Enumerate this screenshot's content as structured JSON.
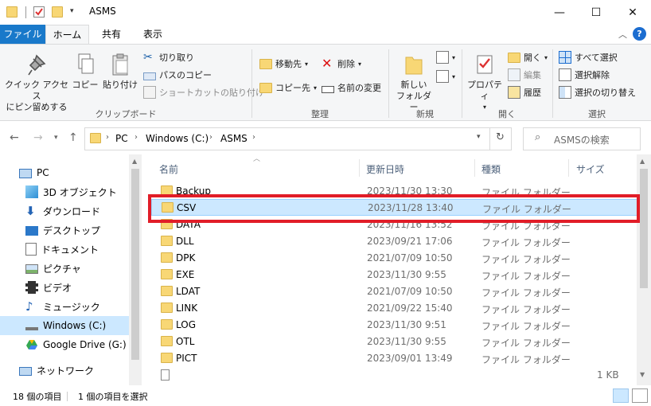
{
  "window": {
    "title": "ASMS",
    "minimize": "—",
    "maximize": "☐",
    "close": "✕"
  },
  "tabs": [
    "ファイル",
    "ホーム",
    "共有",
    "表示"
  ],
  "ribbon": {
    "clipboard": {
      "label": "クリップボード",
      "pin_line1": "クイック アクセス",
      "pin_line2": "にピン留めする",
      "copy": "コピー",
      "paste": "貼り付け",
      "cut": "切り取り",
      "copy_path": "パスのコピー",
      "paste_shortcut": "ショートカットの貼り付け"
    },
    "organize": {
      "label": "整理",
      "move_to": "移動先",
      "copy_to": "コピー先",
      "delete": "削除",
      "rename": "名前の変更"
    },
    "new": {
      "label": "新規",
      "new_folder_line1": "新しい",
      "new_folder_line2": "フォルダー"
    },
    "open": {
      "label": "開く",
      "properties": "プロパティ",
      "open": "開く",
      "edit": "編集",
      "history": "履歴"
    },
    "select": {
      "label": "選択",
      "select_all": "すべて選択",
      "select_none": "選択解除",
      "invert": "選択の切り替え"
    }
  },
  "address": {
    "crumbs": [
      "PC",
      "Windows (C:)",
      "ASMS"
    ],
    "search_placeholder": "ASMSの検索"
  },
  "nav": [
    {
      "label": "PC",
      "icon": "pc-icon"
    },
    {
      "label": "3D オブジェクト",
      "icon": "3d-objects-icon"
    },
    {
      "label": "ダウンロード",
      "icon": "download-icon"
    },
    {
      "label": "デスクトップ",
      "icon": "desktop-icon"
    },
    {
      "label": "ドキュメント",
      "icon": "documents-icon"
    },
    {
      "label": "ピクチャ",
      "icon": "pictures-icon"
    },
    {
      "label": "ビデオ",
      "icon": "videos-icon"
    },
    {
      "label": "ミュージック",
      "icon": "music-icon"
    },
    {
      "label": "Windows (C:)",
      "icon": "drive-icon",
      "selected": true
    },
    {
      "label": "Google Drive (G:)",
      "icon": "google-drive-icon"
    },
    {
      "label": "ネットワーク",
      "icon": "network-icon"
    }
  ],
  "columns": [
    "名前",
    "更新日時",
    "種類",
    "サイズ"
  ],
  "files": [
    {
      "name": "Backup",
      "date": "2023/11/30 13:30",
      "type": "ファイル フォルダー"
    },
    {
      "name": "CSV",
      "date": "2023/11/28 13:40",
      "type": "ファイル フォルダー",
      "selected": true
    },
    {
      "name": "DATA",
      "date": "2023/11/16 13:52",
      "type": "ファイル フォルダー"
    },
    {
      "name": "DLL",
      "date": "2023/09/21 17:06",
      "type": "ファイル フォルダー"
    },
    {
      "name": "DPK",
      "date": "2021/07/09 10:50",
      "type": "ファイル フォルダー"
    },
    {
      "name": "EXE",
      "date": "2023/11/30 9:55",
      "type": "ファイル フォルダー"
    },
    {
      "name": "LDAT",
      "date": "2021/07/09 10:50",
      "type": "ファイル フォルダー"
    },
    {
      "name": "LINK",
      "date": "2021/09/22 15:40",
      "type": "ファイル フォルダー"
    },
    {
      "name": "LOG",
      "date": "2023/11/30 9:51",
      "type": "ファイル フォルダー"
    },
    {
      "name": "OTL",
      "date": "2023/11/30 9:55",
      "type": "ファイル フォルダー"
    },
    {
      "name": "PICT",
      "date": "2023/09/01 13:49",
      "type": "ファイル フォルダー"
    }
  ],
  "partial_row": {
    "size": "1 KB"
  },
  "status": {
    "count": "18 個の項目",
    "selected": "1 個の項目を選択"
  },
  "colors": {
    "accent": "#1979ca",
    "selection": "#cce8ff",
    "highlight_box": "#e11d28",
    "folder": "#f8d775"
  }
}
